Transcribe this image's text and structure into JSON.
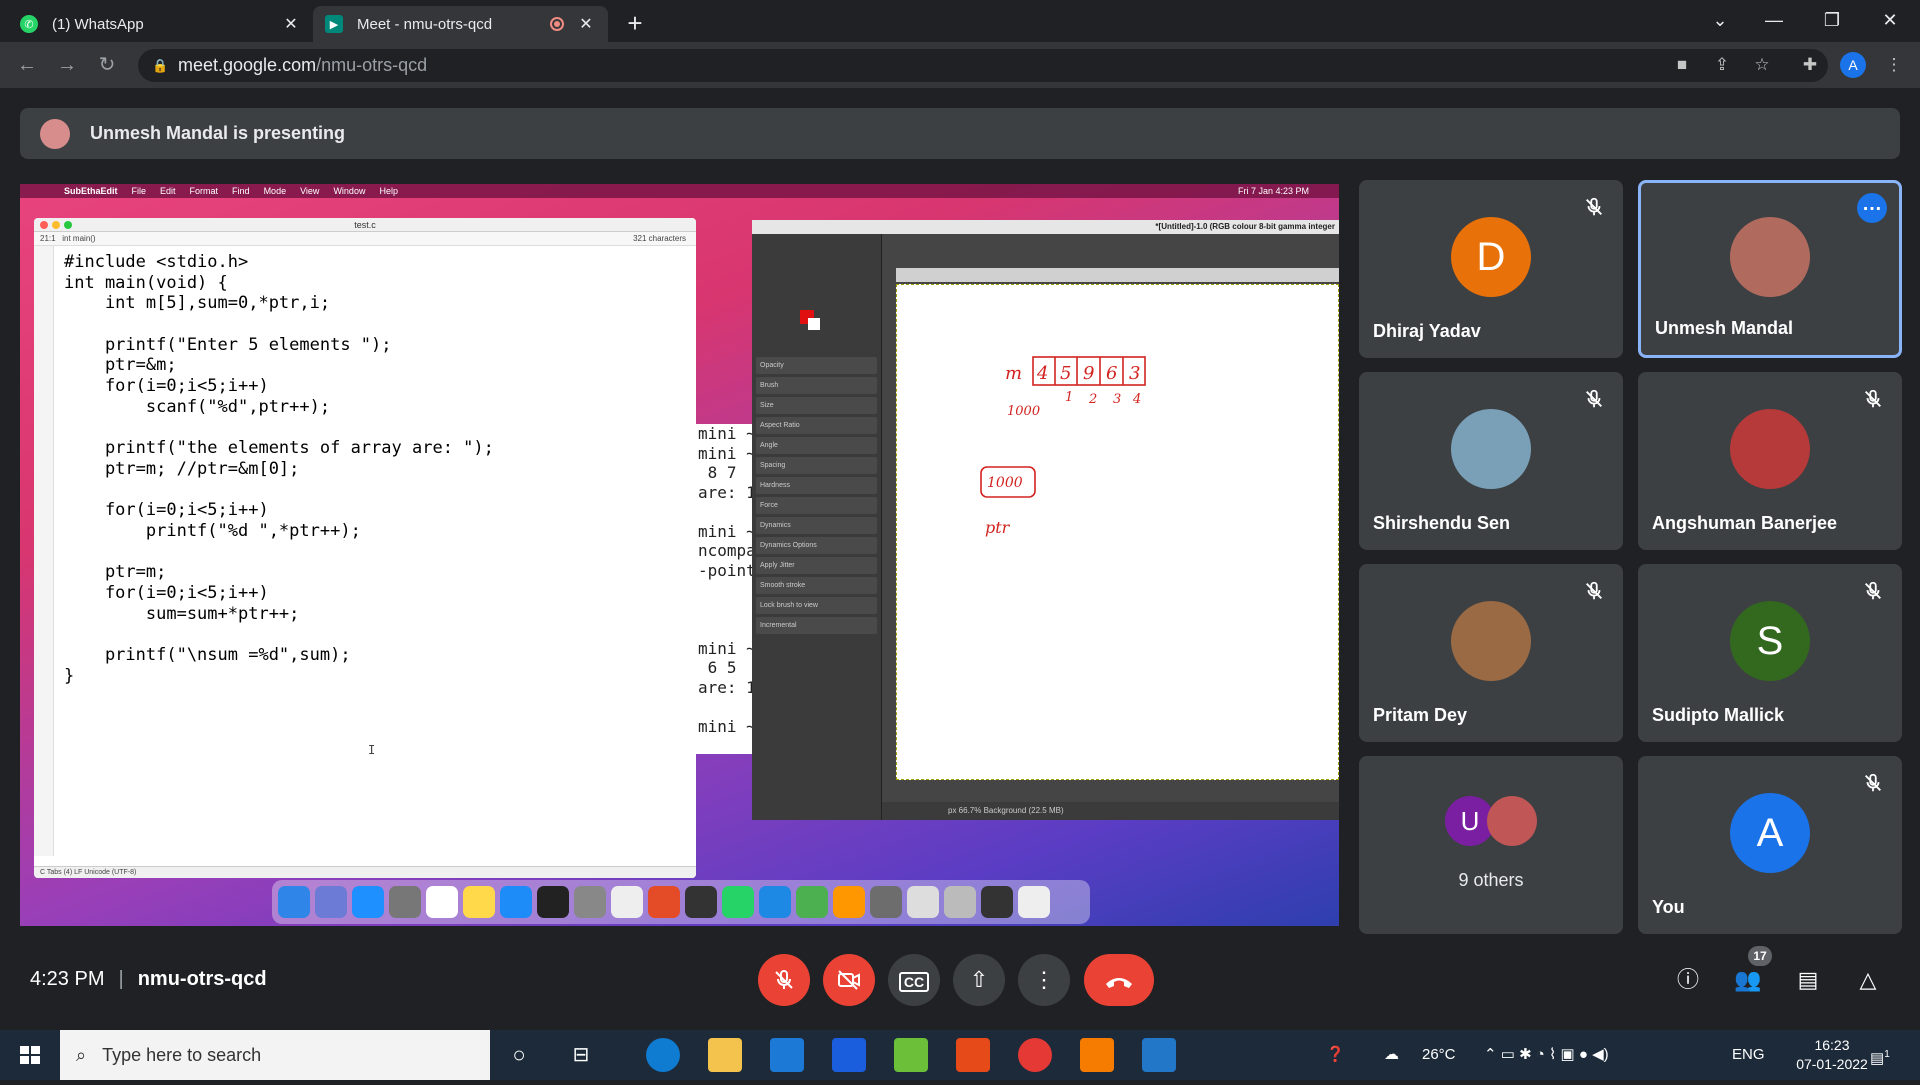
{
  "browser": {
    "tabs": [
      {
        "title": "(1) WhatsApp",
        "active": false
      },
      {
        "title": "Meet - nmu-otrs-qcd",
        "active": true
      }
    ],
    "url_host": "meet.google.com",
    "url_path": "/nmu-otrs-qcd",
    "profile_initial": "A"
  },
  "meet": {
    "presenting_banner": "Unmesh Mandal is presenting",
    "time": "4:23 PM",
    "meeting_code": "nmu-otrs-qcd",
    "participant_count": "17",
    "participants": [
      {
        "name": "Dhiraj Yadav",
        "initial": "D",
        "color": "#e8710a",
        "muted": true
      },
      {
        "name": "Unmesh Mandal",
        "initial": "",
        "color": "#b06b5e",
        "muted": false,
        "active": true
      },
      {
        "name": "Shirshendu Sen",
        "initial": "",
        "color": "#7aa0b8",
        "muted": true
      },
      {
        "name": "Angshuman Banerjee",
        "initial": "",
        "color": "#b63a3a",
        "muted": true
      },
      {
        "name": "Pritam Dey",
        "initial": "",
        "color": "#9a6a44",
        "muted": true
      },
      {
        "name": "Sudipto Mallick",
        "initial": "S",
        "color": "#33691e",
        "muted": true
      },
      {
        "name": "You",
        "initial": "A",
        "color": "#1a73e8",
        "muted": true
      }
    ],
    "others": {
      "initial": "U",
      "label": "9 others"
    }
  },
  "shared_screen": {
    "menubar": [
      "SubEthaEdit",
      "File",
      "Edit",
      "Format",
      "Find",
      "Mode",
      "View",
      "Window",
      "Help"
    ],
    "menubar_right": "Fri 7 Jan  4:23 PM",
    "editor_title": "test.c",
    "editor_position": "21:1",
    "editor_scope": "int main()",
    "editor_chars": "321 characters",
    "editor_status": "C   Tabs (4)   LF   Unicode (UTF-8)",
    "code_lines": [
      "#include <stdio.h>",
      "int main(void) {",
      "    int m[5],sum=0,*ptr,i;",
      "",
      "    printf(\"Enter 5 elements \");",
      "    ptr=&m;",
      "    for(i=0;i<5;i++)",
      "        scanf(\"%d\",ptr++);",
      "",
      "    printf(\"the elements of array are: \");",
      "    ptr=m; //ptr=&m[0];",
      "",
      "    for(i=0;i<5;i++)",
      "        printf(\"%d \",*ptr++);",
      "",
      "    ptr=m;",
      "    for(i=0;i<5;i++)",
      "        sum=sum+*ptr++;",
      "",
      "    printf(\"\\nsum =%d\",sum);",
      "}"
    ],
    "terminal_lines": [
      "mini ~",
      "mini ~",
      " 8 7",
      "are: 1",
      "",
      "mini ~",
      "ncompa",
      "-point",
      "",
      "",
      "",
      "mini ~",
      " 6 5",
      "are: 1",
      "",
      "mini ~"
    ],
    "gimp_title": "*[Untitled]-1.0 (RGB colour 8-bit gamma integer",
    "gimp_tool_rows": [
      "Opacity",
      "Brush",
      "Size",
      "Aspect Ratio",
      "Angle",
      "Spacing",
      "Hardness",
      "Force",
      "Dynamics",
      "Dynamics Options",
      "Apply Jitter",
      "Smooth stroke",
      "Lock brush to view",
      "Incremental"
    ],
    "gimp_status": "px   66.7%   Background (22.5 MB)",
    "drawing": {
      "array_label": "m",
      "values": [
        "4",
        "5",
        "9",
        "6",
        "3"
      ],
      "indices": [
        "1000",
        "1",
        "2",
        "3",
        "4"
      ],
      "box_value": "1000",
      "ptr_label": "ptr"
    }
  },
  "taskbar": {
    "search_placeholder": "Type here to search",
    "weather": "26°C",
    "language": "ENG",
    "time": "16:23",
    "date": "07-01-2022",
    "notification_count": "1"
  }
}
